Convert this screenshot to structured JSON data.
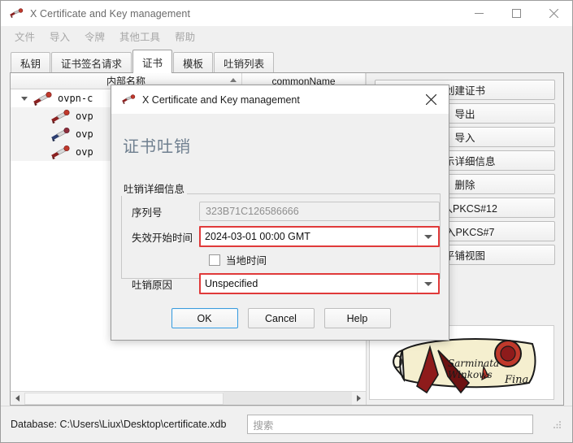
{
  "window": {
    "title": "X Certificate and Key management",
    "icon": "xca-app-icon",
    "controls": {
      "minimize": "—",
      "maximize": "☐",
      "close": "✕"
    }
  },
  "menubar": {
    "items": [
      {
        "label": "文件"
      },
      {
        "label": "导入"
      },
      {
        "label": "令牌"
      },
      {
        "label": "其他工具"
      },
      {
        "label": "帮助"
      }
    ]
  },
  "tabs": [
    {
      "label": "私钥",
      "active": false
    },
    {
      "label": "证书签名请求",
      "active": false
    },
    {
      "label": "证书",
      "active": true
    },
    {
      "label": "模板",
      "active": false
    },
    {
      "label": "吐销列表",
      "active": false
    }
  ],
  "table": {
    "columns": [
      {
        "label": "内部名称",
        "sorted": true
      },
      {
        "label": "commonName",
        "sorted": false
      }
    ],
    "rows": [
      {
        "label": "ovpn-c",
        "indent": 0,
        "expander": true,
        "ribbon": "dark-red"
      },
      {
        "label": "ovp",
        "indent": 1,
        "expander": false,
        "ribbon": "dark-red"
      },
      {
        "label": "ovp",
        "indent": 1,
        "expander": false,
        "ribbon": "blue"
      },
      {
        "label": "ovp",
        "indent": 1,
        "expander": false,
        "ribbon": "dark-red"
      }
    ]
  },
  "side_buttons": [
    {
      "label": "创建证书"
    },
    {
      "label": "导出"
    },
    {
      "label": "导入"
    },
    {
      "label": "显示详细信息"
    },
    {
      "label": "删除"
    },
    {
      "label": "导入PKCS#12"
    },
    {
      "label": "导入PKCS#7"
    },
    {
      "label": "平铺视图"
    }
  ],
  "statusbar": {
    "database_label": "Database: C:\\Users\\Liux\\Desktop\\certificate.xdb",
    "search_placeholder": "搜索",
    "search_value": ""
  },
  "dialog": {
    "title": "X Certificate and Key management",
    "close_icon": "✕",
    "heading": "证书吐销",
    "group_label": "吐销详细信息",
    "fields": {
      "serial": {
        "label": "序列号",
        "value": "323B71C126586666",
        "readonly": true
      },
      "invalid_from": {
        "label": "失效开始时间",
        "value": "2024-03-01 00:00 GMT"
      },
      "local_time": {
        "label": "当地时间",
        "checked": false
      },
      "reason": {
        "label": "吐销原因",
        "value": "Unspecified"
      }
    },
    "buttons": [
      {
        "label": "OK",
        "default": true
      },
      {
        "label": "Cancel",
        "default": false
      },
      {
        "label": "Help",
        "default": false
      }
    ]
  },
  "colors": {
    "focus_red": "#e03a3a",
    "default_blue": "#3a9bdc",
    "heading_slate": "#6f7f8f",
    "window_bg": "#f0f0f0"
  }
}
